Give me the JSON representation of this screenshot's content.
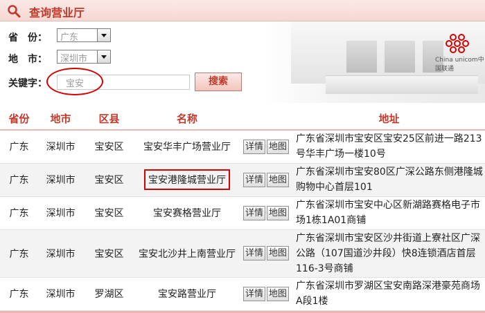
{
  "header": {
    "title": "查询营业厅"
  },
  "form": {
    "province_label": "省　份：",
    "province_value": "广东",
    "city_label": "地　市：",
    "city_value": "深圳市",
    "keyword_label": "关键字：",
    "keyword_value": "宝安",
    "search_label": "搜索"
  },
  "brand": {
    "text": "China unicom中国联通"
  },
  "table": {
    "headers": [
      "省份",
      "地市",
      "区县",
      "名称",
      "",
      "地址"
    ],
    "detail_label": "详情",
    "map_label": "地图",
    "rows": [
      {
        "province": "广东",
        "city": "深圳市",
        "district": "宝安区",
        "name": "宝安华丰广场营业厅",
        "address": "广东省深圳市宝安区宝安25区前进一路213号华丰广场一楼10号"
      },
      {
        "province": "广东",
        "city": "深圳市",
        "district": "宝安区",
        "name": "宝安港隆城营业厅",
        "address": "广东省深圳市宝安80区广深公路东侧港隆城购物中心首层101"
      },
      {
        "province": "广东",
        "city": "深圳市",
        "district": "宝安区",
        "name": "宝安赛格营业厅",
        "address": "广东省深圳市宝安中心区新湖路赛格电子市场1栋1A01商铺"
      },
      {
        "province": "广东",
        "city": "深圳市",
        "district": "宝安区",
        "name": "宝安北沙井上南营业厅",
        "address": "广东省深圳市宝安区沙井街道上寮社区广深公路（107国道沙井段）快8连锁酒店首层116-3号商铺"
      },
      {
        "province": "广东",
        "city": "深圳市",
        "district": "罗湖区",
        "name": "宝安路营业厅",
        "address": "广东省深圳市罗湖区宝安南路深港豪苑商场A段1楼"
      }
    ]
  },
  "colors": {
    "accent": "#c0392b",
    "highlight": "#d40000",
    "header_bg": "#f6d7d2"
  }
}
